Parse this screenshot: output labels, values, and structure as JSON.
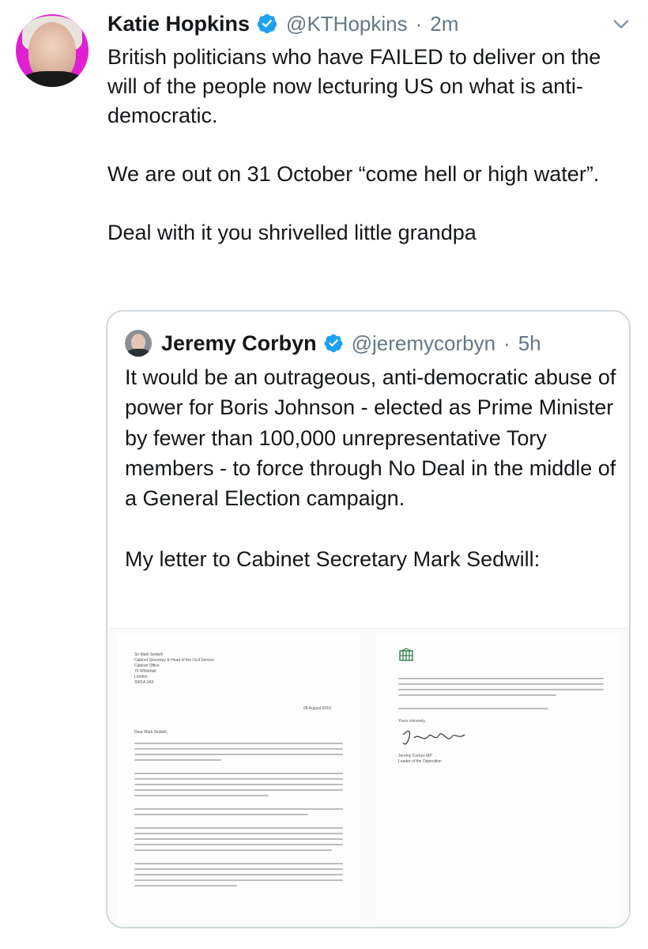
{
  "tweet": {
    "author_name": "Katie Hopkins",
    "author_handle": "@KTHopkins",
    "timestamp": "2m",
    "separator": "·",
    "text": "British politicians who have FAILED to deliver on the will of the people now lecturing US on what is anti-democratic.\n\nWe are out on 31 October “come hell or high water”.\n\nDeal with it you shrivelled little grandpa",
    "verified_icon": "verified-badge-icon",
    "menu_icon": "chevron-down-icon"
  },
  "quoted_tweet": {
    "author_name": "Jeremy Corbyn",
    "author_handle": "@jeremycorbyn",
    "timestamp": "5h",
    "separator": "·",
    "text": "It would be an outrageous, anti-democratic abuse of power for Boris Johnson - elected as Prime Minister by fewer than 100,000 unrepresentative Tory members - to force through No Deal in the middle of a General Election campaign.\n\nMy letter to Cabinet Secretary Mark Sedwill:",
    "verified_icon": "verified-badge-icon"
  },
  "letter": {
    "address": [
      "Sir Mark Sedwill",
      "Cabinet Secretary & Head of the Civil Service",
      "Cabinet Office",
      "70 Whitehall",
      "London",
      "SW1A 2AS"
    ],
    "date": "08 August 2019",
    "salutation": "Dear Mark Sedwill,",
    "closing": "Yours sincerely,",
    "signatory": [
      "Jeremy Corbyn MP",
      "Leader of the Opposition"
    ]
  },
  "colors": {
    "accent": "#1da1f2",
    "secondary_text": "#657786",
    "border": "#cfd9de",
    "avatar_bg": "#e020d0"
  }
}
